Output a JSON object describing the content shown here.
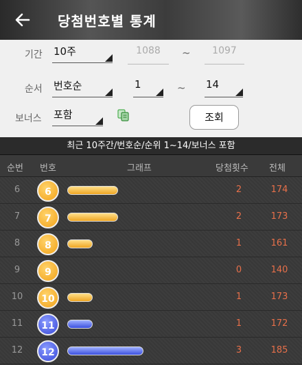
{
  "header": {
    "title": "당첨번호별 통계"
  },
  "filters": {
    "period_label": "기간",
    "period_value": "10주",
    "range_from": "1088",
    "range_to": "1097",
    "tilde": "~",
    "order_label": "순서",
    "order_value": "번호순",
    "rank_from": "1",
    "rank_to": "14",
    "bonus_label": "보너스",
    "bonus_value": "포함",
    "search_button": "조회"
  },
  "summary": "최근 10주간/번호순/순위 1~14/보너스 포함",
  "columns": [
    "순번",
    "번호",
    "그래프",
    "당첨횟수",
    "전체"
  ],
  "rows": [
    {
      "rank": "6",
      "number": "6",
      "count": 2,
      "total": "174",
      "color": "orange"
    },
    {
      "rank": "7",
      "number": "7",
      "count": 2,
      "total": "173",
      "color": "orange"
    },
    {
      "rank": "8",
      "number": "8",
      "count": 1,
      "total": "161",
      "color": "orange"
    },
    {
      "rank": "9",
      "number": "9",
      "count": 0,
      "total": "140",
      "color": "orange"
    },
    {
      "rank": "10",
      "number": "10",
      "count": 1,
      "total": "173",
      "color": "orange"
    },
    {
      "rank": "11",
      "number": "11",
      "count": 1,
      "total": "172",
      "color": "blue"
    },
    {
      "rank": "12",
      "number": "12",
      "count": 3,
      "total": "185",
      "color": "blue"
    }
  ],
  "colors": {
    "orange": "#f2a21a",
    "blue": "#3848d8",
    "count_text": "#e8704a"
  }
}
